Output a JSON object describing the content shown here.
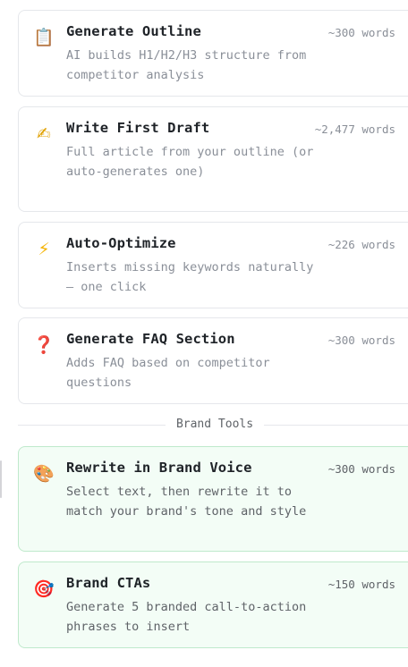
{
  "actions": [
    {
      "icon": "clipboard-icon",
      "glyph": "📋",
      "title": "Generate Outline",
      "description": "AI builds H1/H2/H3 structure from competitor analysis",
      "words": "~300 words"
    },
    {
      "icon": "writing-hand-icon",
      "glyph": "✍",
      "title": "Write First Draft",
      "description": "Full article from your outline (or auto-generates one)",
      "words": "~2,477 words"
    },
    {
      "icon": "lightning-icon",
      "glyph": "⚡",
      "title": "Auto-Optimize",
      "description": "Inserts missing keywords naturally — one click",
      "words": "~226 words"
    },
    {
      "icon": "question-mark-icon",
      "glyph": "❓",
      "title": "Generate FAQ Section",
      "description": "Adds FAQ based on competitor questions",
      "words": "~300 words"
    }
  ],
  "section_label": "Brand Tools",
  "brand_tools": [
    {
      "icon": "palette-icon",
      "glyph": "🎨",
      "title": "Rewrite in Brand Voice",
      "description": "Select text, then rewrite it to match your brand's tone and style",
      "words": "~300 words"
    },
    {
      "icon": "target-icon",
      "glyph": "🎯",
      "title": "Brand CTAs",
      "description": "Generate 5 branded call-to-action phrases to insert",
      "words": "~150 words"
    }
  ],
  "colors": {
    "title": "#1f2328",
    "muted": "#8a8f98",
    "brand_bg": "#f3fdf6",
    "brand_border": "#bfe9cc",
    "lightning": "#f5b301",
    "question": "#d93025"
  }
}
